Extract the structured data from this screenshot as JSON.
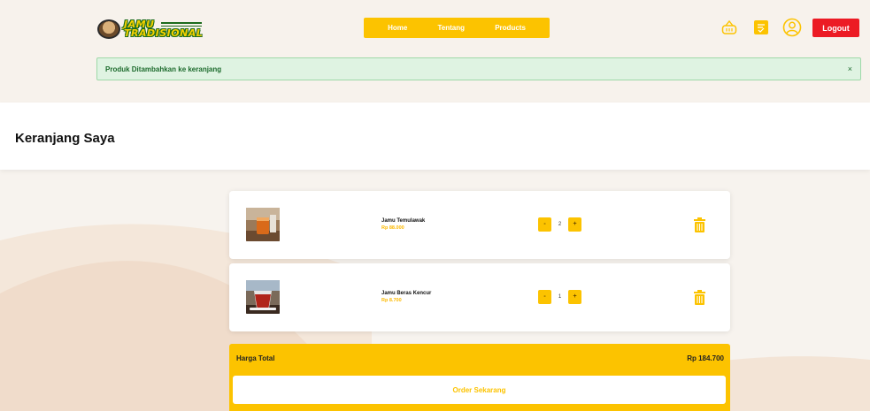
{
  "brand": {
    "logo_line1": "JAMU",
    "logo_line2": "TRADISIONAL"
  },
  "nav": {
    "items": [
      {
        "label": "Home"
      },
      {
        "label": "Tentang"
      },
      {
        "label": "Products"
      }
    ],
    "logout_label": "Logout"
  },
  "header_icons": [
    "basket-icon",
    "order-list-icon",
    "user-icon"
  ],
  "alert": {
    "message": "Produk Ditambahkan ke keranjang",
    "close_label": "×"
  },
  "page": {
    "title": "Keranjang Saya"
  },
  "cart": {
    "items": [
      {
        "name": "Jamu Temulawak",
        "price": "Rp 88.000",
        "quantity": "2",
        "minus": "-",
        "plus": "+"
      },
      {
        "name": "Jamu Beras Kencur",
        "price": "Rp 8.700",
        "quantity": "1",
        "minus": "-",
        "plus": "+"
      }
    ],
    "total_label": "Harga Total",
    "total_value": "Rp 184.700",
    "order_label": "Order Sekarang"
  },
  "colors": {
    "accent": "#fcc300",
    "danger": "#ec1b24",
    "success_bg": "#dff3e2",
    "success_text": "#1d6b2d",
    "page_bg": "#f7f3ee"
  }
}
